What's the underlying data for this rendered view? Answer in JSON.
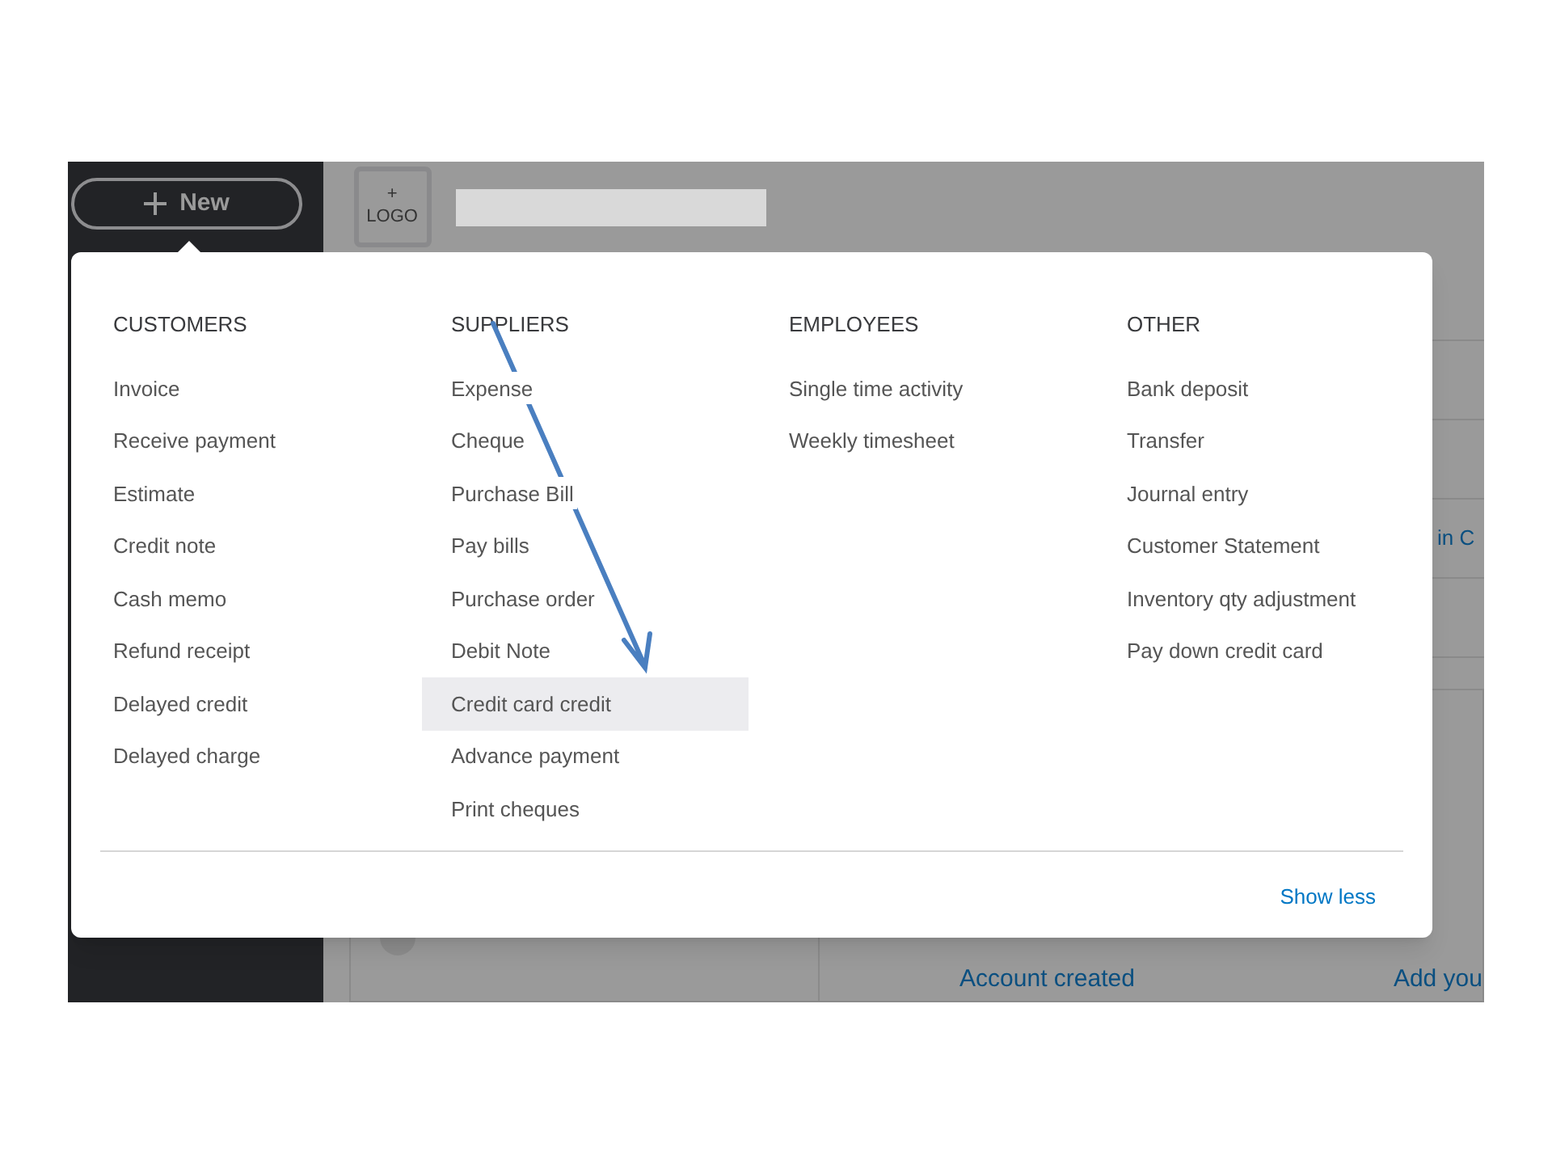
{
  "new_button": {
    "label": "New"
  },
  "logo_button": {
    "plus": "+",
    "label": "LOGO"
  },
  "background": {
    "status": "Account created",
    "cut_link": "Add you",
    "cut_text": "in C"
  },
  "menu": {
    "columns": [
      {
        "heading": "CUSTOMERS",
        "items": [
          {
            "label": "Invoice",
            "selected": false
          },
          {
            "label": "Receive payment",
            "selected": false
          },
          {
            "label": "Estimate",
            "selected": false
          },
          {
            "label": "Credit note",
            "selected": false
          },
          {
            "label": "Cash memo",
            "selected": false
          },
          {
            "label": "Refund receipt",
            "selected": false
          },
          {
            "label": "Delayed credit",
            "selected": false
          },
          {
            "label": "Delayed charge",
            "selected": false
          }
        ]
      },
      {
        "heading": "SUPPLIERS",
        "items": [
          {
            "label": "Expense",
            "selected": false
          },
          {
            "label": "Cheque",
            "selected": false
          },
          {
            "label": "Purchase Bill",
            "selected": false
          },
          {
            "label": "Pay bills",
            "selected": false
          },
          {
            "label": "Purchase order",
            "selected": false
          },
          {
            "label": "Debit Note",
            "selected": false
          },
          {
            "label": "Credit card credit",
            "selected": true
          },
          {
            "label": "Advance payment",
            "selected": false
          },
          {
            "label": "Print cheques",
            "selected": false
          }
        ]
      },
      {
        "heading": "EMPLOYEES",
        "items": [
          {
            "label": "Single time activity",
            "selected": false
          },
          {
            "label": "Weekly timesheet",
            "selected": false
          }
        ]
      },
      {
        "heading": "OTHER",
        "items": [
          {
            "label": "Bank deposit",
            "selected": false
          },
          {
            "label": "Transfer",
            "selected": false
          },
          {
            "label": "Journal entry",
            "selected": false
          },
          {
            "label": "Customer Statement",
            "selected": false
          },
          {
            "label": "Inventory qty adjustment",
            "selected": false
          },
          {
            "label": "Pay down credit card",
            "selected": false
          }
        ]
      }
    ],
    "footer_link": "Show less"
  }
}
